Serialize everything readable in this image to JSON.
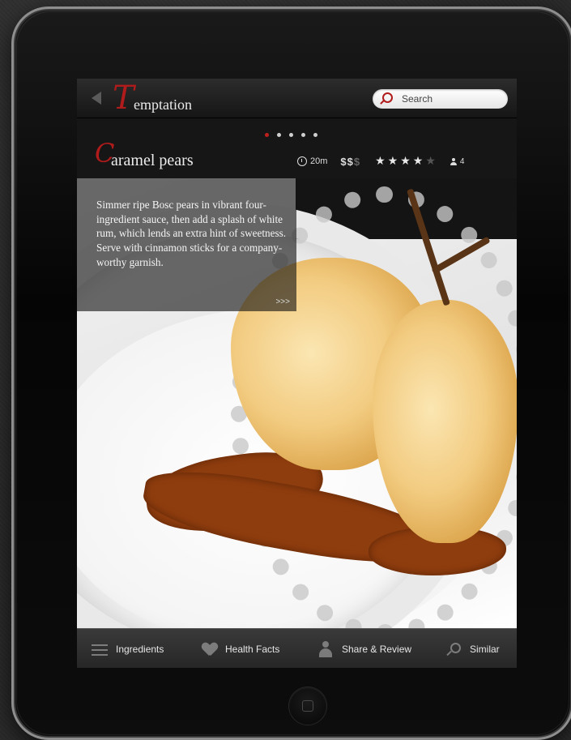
{
  "app": {
    "logo_initial": "T",
    "logo_rest": "emptation",
    "back_icon": "back-arrow-icon"
  },
  "search": {
    "placeholder": "Search",
    "icon": "search-icon"
  },
  "pager": {
    "total": 5,
    "active_index": 0
  },
  "recipe": {
    "title_initial": "C",
    "title_rest": "aramel pears",
    "time": "20m",
    "price_active": "$$",
    "price_inactive": "$",
    "rating": 4,
    "rating_max": 5,
    "servings": "4",
    "description": "Simmer ripe Bosc pears in vibrant four-ingredient sauce, then add a splash of white rum, which lends an extra hint of sweetness. Serve with cinnamon sticks for a company-worthy garnish.",
    "more_label": ">>>"
  },
  "tabs": [
    {
      "label": "Ingredients",
      "icon": "list-icon"
    },
    {
      "label": "Health Facts",
      "icon": "heart-icon"
    },
    {
      "label": "Share & Review",
      "icon": "person-icon"
    },
    {
      "label": "Similar",
      "icon": "magnifier-icon"
    }
  ],
  "colors": {
    "accent": "#b01b1b",
    "background": "#2b2b2b",
    "bar": "#262626"
  }
}
